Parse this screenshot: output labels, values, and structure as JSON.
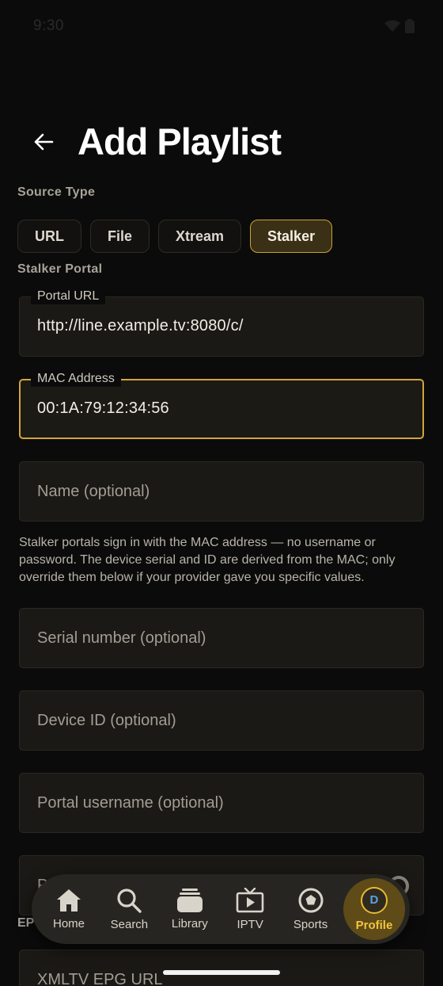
{
  "status_bar": {
    "time": "9:30"
  },
  "header": {
    "title": "Add Playlist"
  },
  "source_type": {
    "label": "Source Type",
    "options": [
      "URL",
      "File",
      "Xtream",
      "Stalker"
    ],
    "selected": "Stalker"
  },
  "stalker": {
    "section_label": "Stalker Portal",
    "portal_url": {
      "label": "Portal URL",
      "value": "http://line.example.tv:8080/c/"
    },
    "mac_address": {
      "label": "MAC Address",
      "value": "00:1A:79:12:34:56"
    },
    "name": {
      "placeholder": "Name (optional)"
    },
    "helper": "Stalker portals sign in with the MAC address — no username or password. The device serial and ID are derived from the MAC; only override them below if your provider gave you specific values.",
    "serial": {
      "placeholder": "Serial number (optional)"
    },
    "device_id": {
      "placeholder": "Device ID (optional)"
    },
    "portal_username": {
      "placeholder": "Portal username (optional)"
    },
    "portal_password": {
      "placeholder": "P"
    }
  },
  "epg": {
    "section_label": "EP",
    "xmltv": {
      "placeholder": "XMLTV EPG URL"
    }
  },
  "bottom_nav": {
    "items": [
      {
        "label": "Home",
        "icon": "home-icon"
      },
      {
        "label": "Search",
        "icon": "search-icon"
      },
      {
        "label": "Library",
        "icon": "library-icon"
      },
      {
        "label": "IPTV",
        "icon": "tv-icon"
      },
      {
        "label": "Sports",
        "icon": "sports-icon"
      },
      {
        "label": "Profile",
        "icon": "avatar",
        "avatar_initial": "D"
      }
    ],
    "active": "Profile"
  },
  "colors": {
    "background": "#0b0b0b",
    "accent": "#d3a53a",
    "chip_selected_bg": "#3a3015",
    "field_bg": "#1b1915",
    "nav_active_bg": "#5e4b17",
    "avatar_initial": "#5aa3e6"
  }
}
